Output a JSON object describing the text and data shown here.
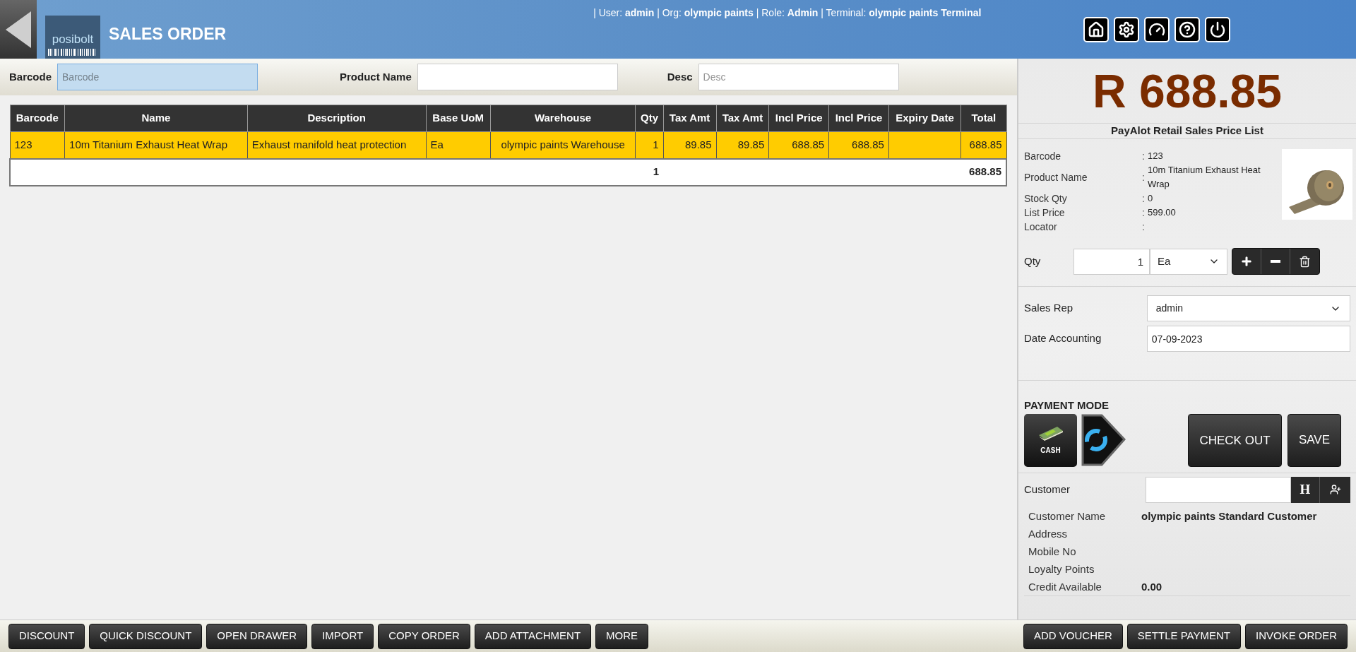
{
  "header": {
    "logo_text": "posibolt",
    "title": "SALES ORDER",
    "session_info": "| User: **admin** | Org: **olympic paints** | Role: **Admin** | Terminal: **olympic paints Terminal**"
  },
  "search": [
    {
      "label": "Barcode",
      "placeholder": "Barcode",
      "focused": true
    },
    {
      "label": "Product Name",
      "focused": false
    },
    {
      "label": "Desc",
      "placeholder": "Desc",
      "focused": false
    }
  ],
  "table": {
    "columns": [
      {
        "label": "Barcode"
      },
      {
        "label": "Name"
      },
      {
        "label": "Description"
      },
      {
        "label": "Base UoM"
      },
      {
        "label": "Warehouse"
      },
      {
        "label": "Qty"
      },
      {
        "label": "Tax Amt"
      },
      {
        "label": "Tax Amt"
      },
      {
        "label": "Incl Price"
      },
      {
        "label": "Incl Price"
      },
      {
        "label": "Expiry Date"
      },
      {
        "label": "Total"
      }
    ],
    "rows": [
      {
        "selected": true,
        "cells": [
          "123",
          "10m Titanium Exhaust Heat Wrap",
          "Exhaust manifold heat protection",
          "Ea",
          "olympic paints Warehouse",
          "1",
          "89.85",
          "89.85",
          "688.85",
          "688.85",
          "",
          "688.85"
        ]
      }
    ],
    "totals": {
      "qty": "1",
      "total": "688.85"
    }
  },
  "summary": {
    "amount": "R 688.85",
    "price_list": "PayAlot Retail Sales Price List",
    "details": [
      {
        "label": "Barcode",
        "separator": ":",
        "value": "123"
      },
      {
        "label": "Product Name",
        "separator": ":",
        "value": "10m Titanium Exhaust Heat Wrap"
      },
      {
        "label": "Stock Qty",
        "separator": ":",
        "value": "0"
      },
      {
        "label": "List Price",
        "separator": ":",
        "value": "599.00"
      },
      {
        "label": "Locator",
        "separator": ":"
      }
    ],
    "qty": {
      "label": "Qty",
      "value": "1",
      "uom": "Ea"
    },
    "sales_rep": {
      "label": "Sales Rep",
      "value": "admin"
    },
    "date_accounting": {
      "label": "Date Accounting",
      "value": "07-09-2023"
    },
    "payment_mode": {
      "title": "PAYMENT MODE",
      "modes": [
        {
          "kind": "cash",
          "label": "CASH"
        },
        {
          "kind": "switch"
        }
      ]
    },
    "actions": [
      {
        "label": "CHECK OUT"
      },
      {
        "label": "SAVE"
      }
    ],
    "customer": {
      "label": "Customer",
      "history_button": "H"
    },
    "customer_details": [
      {
        "label": "Customer Name",
        "value": "olympic paints Standard Customer"
      },
      {
        "label": "Address"
      },
      {
        "label": "Mobile No"
      },
      {
        "label": "Loyalty Points"
      },
      {
        "label": "Credit Available",
        "value": "0.00"
      }
    ]
  },
  "footer": {
    "left_buttons": [
      "DISCOUNT",
      "QUICK DISCOUNT",
      "OPEN DRAWER",
      "IMPORT",
      "COPY ORDER",
      "ADD ATTACHMENT",
      "MORE"
    ],
    "right_buttons": [
      "ADD VOUCHER",
      "SETTLE PAYMENT",
      "INVOKE ORDER"
    ]
  }
}
